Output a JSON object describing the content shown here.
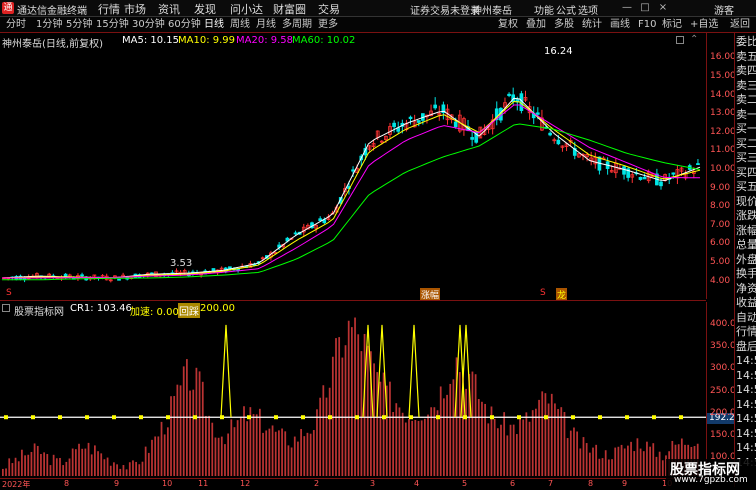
{
  "app": {
    "title": "通达信金融终端",
    "menu": [
      "行情",
      "市场",
      "资讯",
      "发现",
      "问小达",
      "财富圈",
      "交易"
    ],
    "notice": "证券交易未登录",
    "stock_link": "神州泰岳",
    "right_menu": [
      "功能",
      "公式",
      "选项"
    ],
    "guest": "游客",
    "win_buttons": [
      "—",
      "□",
      "×"
    ]
  },
  "period_tabs": [
    "分时",
    "1分钟",
    "5分钟",
    "15分钟",
    "30分钟",
    "60分钟",
    "日线",
    "周线",
    "月线",
    "多周期",
    "更多"
  ],
  "active_tab": "日线",
  "right_tabs": [
    "复权",
    "叠加",
    "多股",
    "统计",
    "画线",
    "F10",
    "标记",
    "+自选",
    "返回"
  ],
  "main": {
    "stock": "神州泰岳(日线,前复权)",
    "ma5": "MA5: 10.15",
    "ma10": "MA10: 9.99",
    "ma20": "MA20: 9.58",
    "ma60": "MA60: 10.02",
    "high_label": "16.24",
    "low_label": "3.53",
    "mark_zt": "涨幅",
    "mark_lt": "龙",
    "mark_s1": "S",
    "mark_s2": "S"
  },
  "indicator": {
    "name": "股票指标网",
    "cr1": "CR1: 103.46",
    "speed": "加速: 0.00",
    "icon": "回踩",
    "value": "200.00",
    "level_label": "192.26"
  },
  "y_axis_main": [
    "16.00",
    "15.00",
    "14.00",
    "13.00",
    "12.00",
    "11.00",
    "10.00",
    "9.00",
    "8.00",
    "7.00",
    "6.00",
    "5.00",
    "4.00"
  ],
  "y_axis_ind": [
    "400.00",
    "350.00",
    "300.00",
    "250.00",
    "200.00",
    "150.00",
    "100.00"
  ],
  "x_axis": [
    "2022年",
    "8",
    "9",
    "10",
    "11",
    "12",
    "2",
    "3",
    "4",
    "5",
    "6",
    "7",
    "8",
    "9",
    "10"
  ],
  "right_panel": [
    "委比",
    "卖五",
    "卖四",
    "卖三",
    "卖二",
    "卖一",
    "买一",
    "买二",
    "买三",
    "买四",
    "买五",
    "现价",
    "涨跌",
    "涨幅",
    "总量",
    "外盘",
    "换手",
    "净资",
    "收益",
    "自动",
    "行情",
    "盘后",
    "14:50",
    "14:50",
    "14:50",
    "14:50",
    "14:50",
    "14:50",
    "14:50",
    "14:50"
  ],
  "watermark": {
    "title": "股票指标网",
    "url": "www.7gpzb.com"
  },
  "colors": {
    "up": "#ff3333",
    "down": "#00e5e5",
    "ma5": "#ffffff",
    "ma10": "#ffff00",
    "ma20": "#ff00ff",
    "ma60": "#00ff00",
    "axis": "#7a1111"
  },
  "chart_data": [
    {
      "type": "line",
      "series": [
        {
          "name": "MA5",
          "values": [
            4.2,
            4.3,
            4.25,
            4.2,
            4.4,
            4.45,
            4.6,
            5.0,
            6.5,
            7.6,
            11.5,
            12.5,
            13.2,
            11.8,
            14.0,
            12.0,
            10.5,
            10.0,
            9.4,
            10.15
          ]
        },
        {
          "name": "MA10",
          "values": [
            4.2,
            4.25,
            4.25,
            4.2,
            4.35,
            4.4,
            4.55,
            4.9,
            6.2,
            7.3,
            11.0,
            12.2,
            13.0,
            12.0,
            13.8,
            12.2,
            10.8,
            10.2,
            9.5,
            9.99
          ]
        },
        {
          "name": "MA20",
          "values": [
            4.2,
            4.2,
            4.22,
            4.22,
            4.3,
            4.35,
            4.5,
            4.7,
            5.8,
            7.0,
            10.3,
            11.6,
            12.4,
            12.0,
            13.6,
            12.4,
            11.2,
            10.4,
            9.6,
            9.58
          ]
        },
        {
          "name": "MA60",
          "values": [
            4.1,
            4.1,
            4.15,
            4.18,
            4.2,
            4.25,
            4.35,
            4.5,
            5.2,
            6.2,
            8.7,
            9.9,
            10.7,
            11.3,
            12.5,
            12.2,
            11.6,
            10.9,
            10.4,
            10.02
          ]
        }
      ],
      "ylim": [
        3.5,
        16.5
      ],
      "y_ticks": [
        "16.00",
        "15.00",
        "14.00",
        "13.00",
        "12.00",
        "11.00",
        "10.00",
        "9.00",
        "8.00",
        "7.00",
        "6.00",
        "5.00",
        "4.00"
      ]
    },
    {
      "type": "bar",
      "values": [
        80,
        95,
        110,
        120,
        100,
        90,
        110,
        130,
        120,
        100,
        90,
        80,
        100,
        140,
        180,
        240,
        290,
        260,
        180,
        150,
        170,
        200,
        190,
        170,
        150,
        140,
        160,
        180,
        260,
        350,
        400,
        370,
        300,
        250,
        230,
        200,
        210,
        220,
        260,
        330,
        300,
        250,
        200,
        180,
        170,
        180,
        210,
        240,
        200,
        160,
        130,
        120,
        110,
        115,
        130,
        140,
        120,
        110,
        130,
        140,
        150
      ],
      "ylim": [
        60,
        420
      ],
      "y_ticks": [
        "400.00",
        "350.00",
        "300.00",
        "250.00",
        "200.00",
        "150.00",
        "100.00"
      ],
      "level": 192.26
    }
  ]
}
